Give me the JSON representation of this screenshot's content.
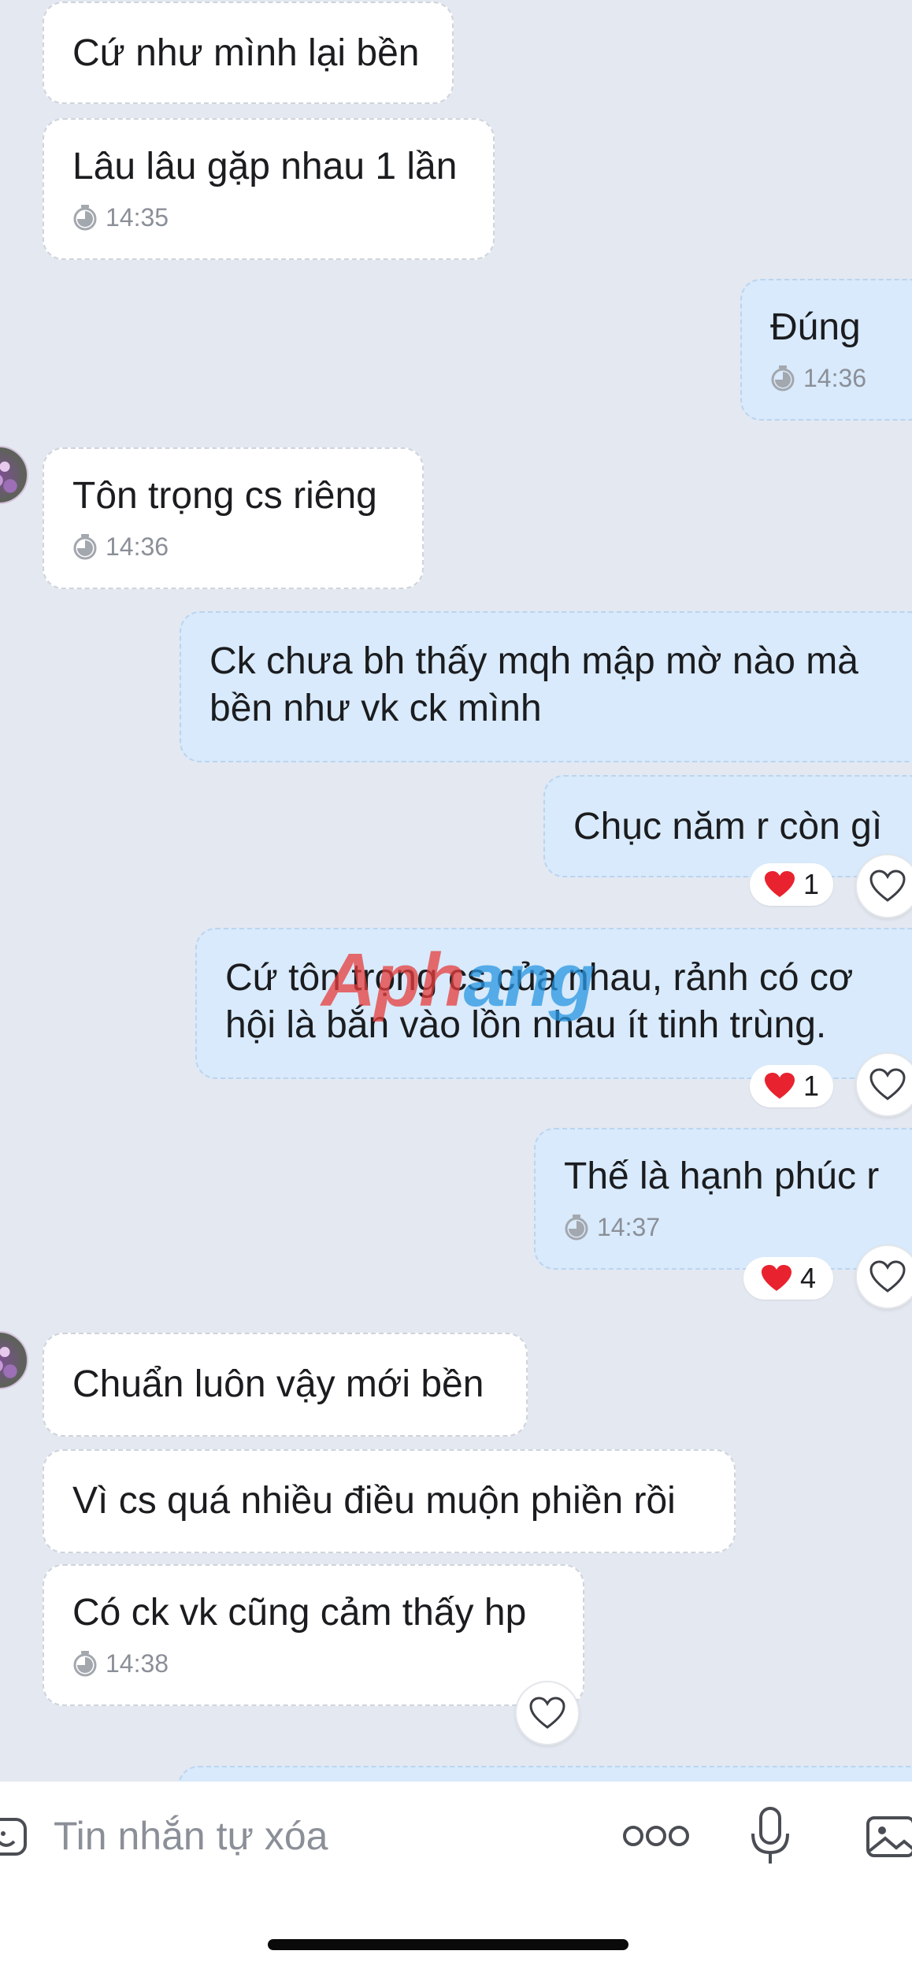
{
  "colors": {
    "background": "#e4e8f1",
    "incoming_bubble": "#ffffff",
    "outgoing_bubble": "#d8eafb",
    "reaction_heart": "#e8232f",
    "muted_text": "#8b8f98"
  },
  "messages": [
    {
      "direction": "incoming",
      "text": "Cứ như mình lại bền"
    },
    {
      "direction": "incoming",
      "text": "Lâu lâu gặp nhau 1 lần",
      "time": "14:35"
    },
    {
      "direction": "outgoing",
      "text": "Đúng",
      "time": "14:36"
    },
    {
      "direction": "incoming",
      "text": "Tôn trọng cs riêng",
      "time": "14:36",
      "avatar": true
    },
    {
      "direction": "outgoing",
      "text": "Ck chưa bh thấy mqh mập mờ nào mà\nbền như vk ck mình"
    },
    {
      "direction": "outgoing",
      "text": "Chục năm r còn gì",
      "reaction": {
        "icon": "heart-icon",
        "count": "1"
      }
    },
    {
      "direction": "outgoing",
      "text": "Cứ tôn trọng cs của nhau, rảnh có cơ\nhội là bắn vào lồn nhau ít tinh trùng.",
      "reaction": {
        "icon": "heart-icon",
        "count": "1"
      }
    },
    {
      "direction": "outgoing",
      "text": "Thế là hạnh phúc r",
      "time": "14:37",
      "reaction": {
        "icon": "heart-icon",
        "count": "4"
      }
    },
    {
      "direction": "incoming",
      "text": "Chuẩn luôn vậy mới bền",
      "avatar": true
    },
    {
      "direction": "incoming",
      "text": "Vì cs quá nhiều điều muộn phiền rồi"
    },
    {
      "direction": "incoming",
      "text": "Có ck vk cũng cảm thấy hp",
      "time": "14:38"
    }
  ],
  "watermark": {
    "part1": "Aph",
    "part2": "ang"
  },
  "input": {
    "placeholder": "Tin nhắn tự xóa",
    "icons": [
      "sticker-icon",
      "more-icon",
      "microphone-icon",
      "gallery-icon"
    ]
  }
}
